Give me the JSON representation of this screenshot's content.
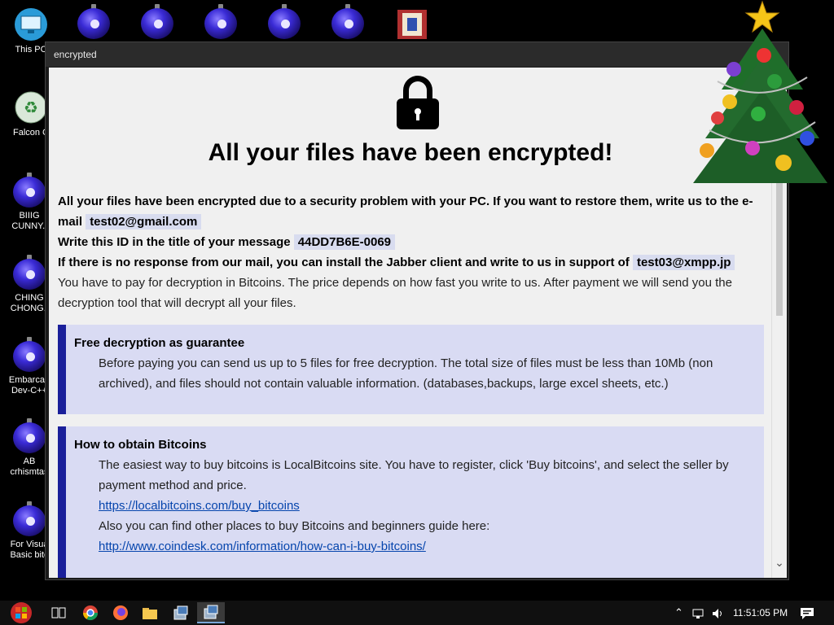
{
  "desktop": {
    "icons": [
      {
        "label": "This PC",
        "icon": "monitor-icon"
      },
      {
        "label": "Falcon C",
        "icon": "recycle-icon"
      },
      {
        "label": "BIIIG\nCUNNY.l",
        "icon": "ornament-icon"
      },
      {
        "label": "CHING\nCHONG.l",
        "icon": "ornament-icon"
      },
      {
        "label": "Embarcad\nDev-C++",
        "icon": "ornament-icon"
      },
      {
        "label": "AB\ncrhismtas",
        "icon": "ornament-icon"
      },
      {
        "label": "For Visua\nBasic bitc",
        "icon": "ornament-icon"
      }
    ]
  },
  "window": {
    "title": "encrypted",
    "headline": "All your files have been encrypted!",
    "p1_a": "All your files have been encrypted due to a security problem with your PC. If you want to restore them, write us to the e-mail",
    "email": "test02@gmail.com",
    "p2_a": "Write this ID in the title of your message",
    "id": "44DD7B6E-0069",
    "p3_a": "If there is no response from our mail, you can install the Jabber client and write to us in support of",
    "jabber": "test03@xmpp.jp",
    "p4": "You have to pay for decryption in Bitcoins. The price depends on how fast you write to us. After payment we will send you the decryption tool that will decrypt all your files.",
    "box1": {
      "title": "Free decryption as guarantee",
      "text": "Before paying you can send us up to 5 files for free decryption. The total size of files must be less than 10Mb (non archived), and files should not contain valuable information. (databases,backups, large excel sheets, etc.)"
    },
    "box2": {
      "title": "How to obtain Bitcoins",
      "text1": "The easiest way to buy bitcoins is LocalBitcoins site. You have to register, click 'Buy bitcoins', and select the seller by payment method and price.",
      "link1": "https://localbitcoins.com/buy_bitcoins",
      "text2": "Also you can find other places to buy Bitcoins and beginners guide here:",
      "link2": "http://www.coindesk.com/information/how-can-i-buy-bitcoins/"
    }
  },
  "taskbar": {
    "clock": "11:51:05 PM",
    "items": [
      "start-button",
      "task-view-icon",
      "chrome-icon",
      "firefox-icon",
      "file-explorer-icon",
      "app-icon",
      "app-active-icon"
    ]
  },
  "colors": {
    "accent": "#1a1f9a",
    "box_bg": "#d9dbf3",
    "link": "#0645ad"
  }
}
